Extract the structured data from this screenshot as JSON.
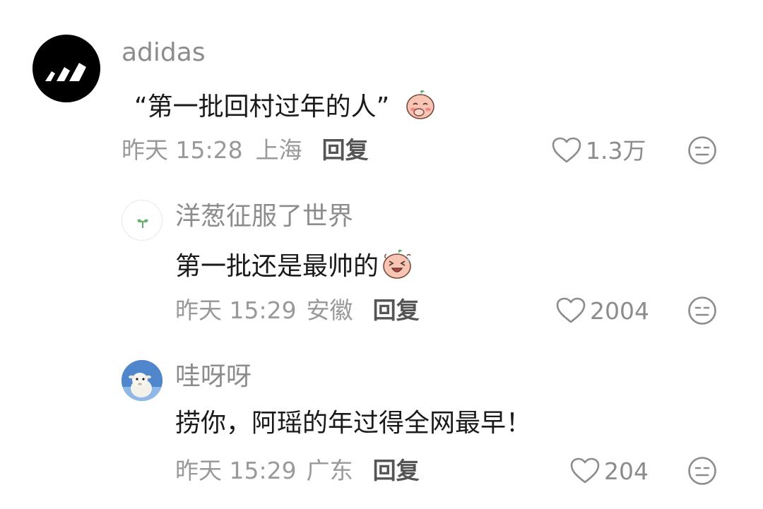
{
  "comments": [
    {
      "username": "adidas",
      "content": "“第一批回村过年的人”",
      "date": "昨天 15:28",
      "location": "上海",
      "reply_label": "回复",
      "likes": "1.3万",
      "avatar_icon": "adidas-logo-icon",
      "emoji_icon": "covering-mouth-peach-emoji-icon"
    },
    {
      "username": "洋葱征服了世界",
      "content": "第一批还是最帅的",
      "date": "昨天 15:29",
      "location": "安徽",
      "reply_label": "回复",
      "likes": "2004",
      "avatar_icon": "sprout-icon",
      "emoji_icon": "laughing-peach-emoji-icon"
    },
    {
      "username": "哇呀呀",
      "content": "捞你，阿瑶的年过得全网最早！",
      "date": "昨天 15:29",
      "location": "广东",
      "reply_label": "回复",
      "likes": "204",
      "avatar_icon": "alpaca-avatar-icon"
    }
  ],
  "colors": {
    "username": "#8c8c8c",
    "meta": "#999999",
    "reply": "#555555",
    "content": "#1a1a1a"
  }
}
